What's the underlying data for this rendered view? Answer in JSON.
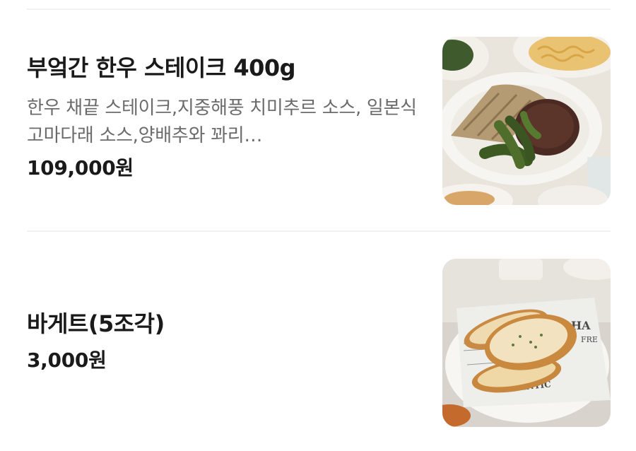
{
  "menu_items": [
    {
      "name": "부엌간 한우 스테이크 400g",
      "description": "한우 채끝 스테이크,지중해풍 치미추르 소스, 일본식 고마다래 소스,양배추와 꽈리…",
      "price": "109,000원",
      "image_alt": "steak-plate-photo"
    },
    {
      "name": "바게트(5조각)",
      "price": "3,000원",
      "image_alt": "baguette-plate-photo",
      "image_text_1": "HA",
      "image_text_2": "FRE",
      "image_text_3": "ENTIC"
    }
  ]
}
